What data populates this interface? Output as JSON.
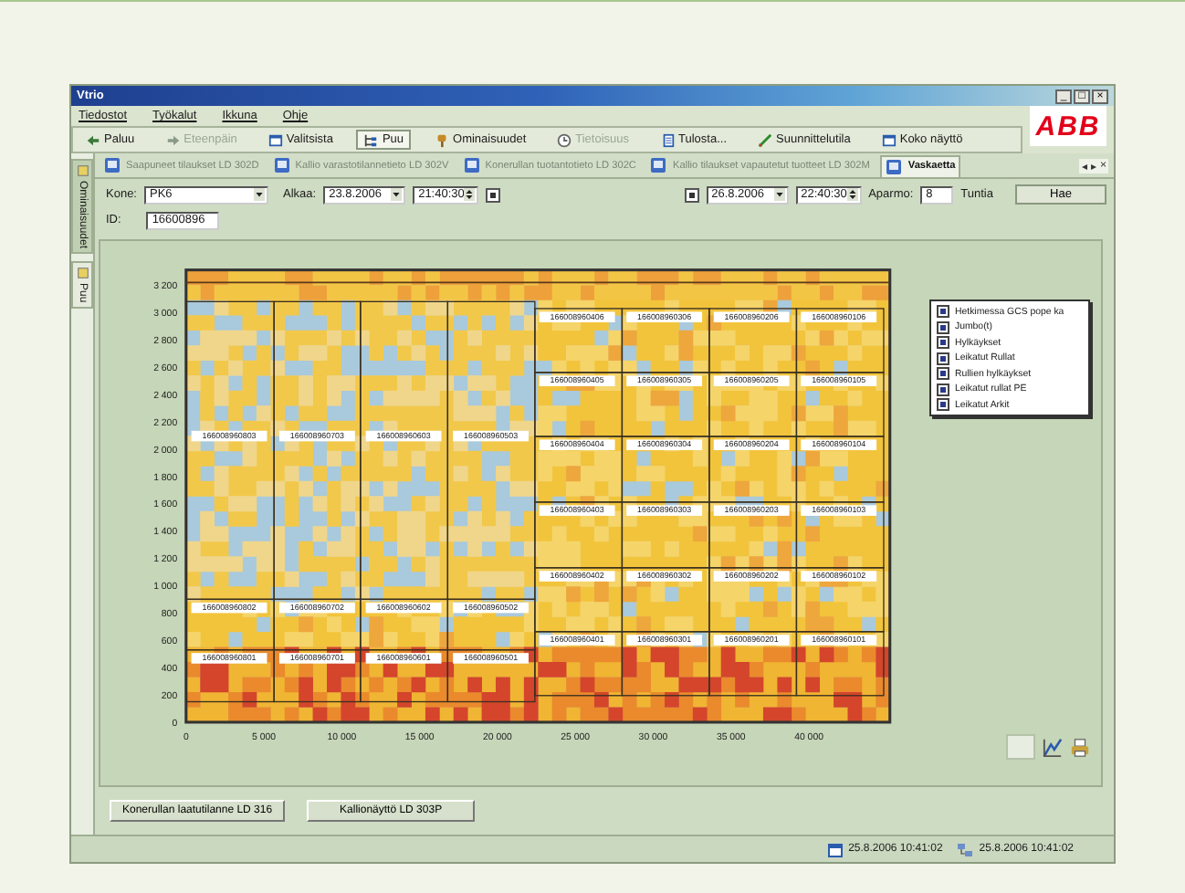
{
  "window": {
    "title": "Vtrio",
    "controls": [
      "_",
      "□",
      "×"
    ]
  },
  "menu": [
    "Tiedostot",
    "Työkalut",
    "Ikkuna",
    "Ohje"
  ],
  "toolbar": [
    {
      "label": "Paluu",
      "kind": "back",
      "disabled": false,
      "pressed": false
    },
    {
      "label": "Eteenpäin",
      "kind": "forward",
      "disabled": true,
      "pressed": false
    },
    {
      "label": "Valitsista",
      "kind": "view",
      "disabled": false,
      "pressed": false
    },
    {
      "label": "Puu",
      "kind": "tree",
      "disabled": false,
      "pressed": true
    },
    {
      "label": "Ominaisuudet",
      "kind": "props",
      "disabled": false,
      "pressed": false
    },
    {
      "label": "Tietoisuus",
      "kind": "info",
      "disabled": true,
      "pressed": false
    },
    {
      "label": "Tulosta...",
      "kind": "print",
      "disabled": false,
      "pressed": false
    },
    {
      "label": "Suunnittelutila",
      "kind": "design",
      "disabled": false,
      "pressed": false
    },
    {
      "label": "Koko näyttö",
      "kind": "view",
      "disabled": false,
      "pressed": false
    }
  ],
  "logo": "ABB",
  "side_tabs": [
    {
      "label": "Ominaisuudet",
      "selected": true
    },
    {
      "label": "Puu",
      "selected": false
    }
  ],
  "doc_tabs": [
    {
      "label": "Saapuneet tilaukset LD 302D",
      "selected": false
    },
    {
      "label": "Kallio varastotilannetieto LD 302V",
      "selected": false
    },
    {
      "label": "Konerullan tuotantotieto LD 302C",
      "selected": false
    },
    {
      "label": "Kallio tilaukset vapautetut tuotteet LD 302M",
      "selected": false
    },
    {
      "label": "Vaskaetta",
      "selected": true
    }
  ],
  "tab_nav": [
    "◂",
    "▸",
    "×"
  ],
  "query": {
    "machine_label": "Kone:",
    "machine": "PK6",
    "start_label": "Alkaa:",
    "start_date": "23.8.2006",
    "start_time": "21:40:30",
    "start_checked": true,
    "end_checked": true,
    "end_date": "26.8.2006",
    "end_time": "22:40:30",
    "span_label": "Aparmo:",
    "span": "8",
    "span_unit": "Tuntia",
    "search_button": "Hae",
    "id_label": "ID:",
    "id": "16600896"
  },
  "chart": {
    "yticks": [
      "3 200",
      "3 000",
      "2 800",
      "2 600",
      "2 400",
      "2 200",
      "2 000",
      "1 800",
      "1 600",
      "1 400",
      "1 200",
      "1 000",
      "800",
      "600",
      "400",
      "200",
      "0"
    ],
    "xticks": [
      "0",
      "5 000",
      "10 000",
      "15 000",
      "20 000",
      "25 000",
      "30 000",
      "35 000",
      "40 000"
    ],
    "left_rolls": [
      [
        "166008960803",
        "166008960703",
        "166008960603",
        "166008960503"
      ],
      [
        "166008960802",
        "166008960702",
        "166008960602",
        "166008960502"
      ],
      [
        "166008960801",
        "166008960701",
        "166008960601",
        "166008960501"
      ]
    ],
    "right_rolls": [
      [
        "166008960406",
        "166008960306",
        "166008960206",
        "166008960106"
      ],
      [
        "166008960405",
        "166008960305",
        "166008960205",
        "166008960105"
      ],
      [
        "166008960404",
        "166008960304",
        "166008960204",
        "166008960104"
      ],
      [
        "166008960403",
        "166008960303",
        "166008960203",
        "166008960103"
      ],
      [
        "166008960402",
        "166008960302",
        "166008960202",
        "166008960102"
      ],
      [
        "166008960401",
        "166008960301",
        "166008960201",
        "166008960101"
      ]
    ]
  },
  "legend": [
    {
      "label": "Hetkimessa GCS pope ka",
      "checked": true
    },
    {
      "label": "Jumbo(t)",
      "checked": true
    },
    {
      "label": "Hylkäykset",
      "checked": true
    },
    {
      "label": "Leikatut Rullat",
      "checked": true
    },
    {
      "label": "Rullien hylkäykset",
      "checked": true
    },
    {
      "label": "Leikatut rullat PE",
      "checked": true
    },
    {
      "label": "Leikatut Arkit",
      "checked": true
    }
  ],
  "bottom_buttons": [
    "Konerullan laatutilanne LD 316",
    "Kallionäyttö LD 303P"
  ],
  "status": [
    {
      "text": "25.8.2006 10:41:02",
      "kind": "calendar"
    },
    {
      "text": "25.8.2006 10:41:02",
      "kind": "network"
    }
  ]
}
